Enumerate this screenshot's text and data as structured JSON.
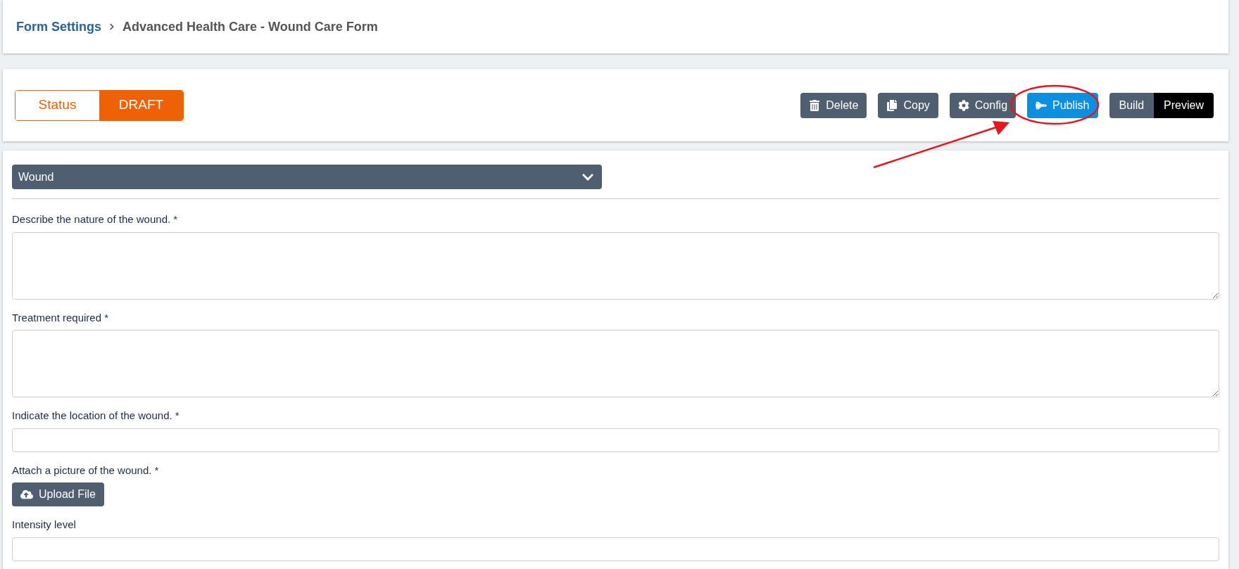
{
  "breadcrumb": {
    "link": "Form Settings",
    "current": "Advanced Health Care - Wound Care Form"
  },
  "status": {
    "label": "Status",
    "value": "DRAFT"
  },
  "actions": [
    {
      "kind": "delete",
      "label": "Delete"
    },
    {
      "kind": "copy",
      "label": "Copy"
    },
    {
      "kind": "config",
      "label": "Config"
    },
    {
      "kind": "publish",
      "label": "Publish"
    }
  ],
  "view_modes": [
    {
      "label": "Build",
      "selected": false
    },
    {
      "label": "Preview",
      "selected": true
    }
  ],
  "section": {
    "title": "Wound",
    "expanded": true
  },
  "fields": [
    {
      "kind": "textarea",
      "label": "Describe the nature of the wound. *"
    },
    {
      "kind": "textarea",
      "label": "Treatment required *"
    },
    {
      "kind": "input",
      "label": "Indicate the location of the wound. *"
    },
    {
      "kind": "upload",
      "label": "Attach a picture of the wound. *",
      "button": "Upload File"
    },
    {
      "kind": "input",
      "label": "Intensity level"
    }
  ]
}
